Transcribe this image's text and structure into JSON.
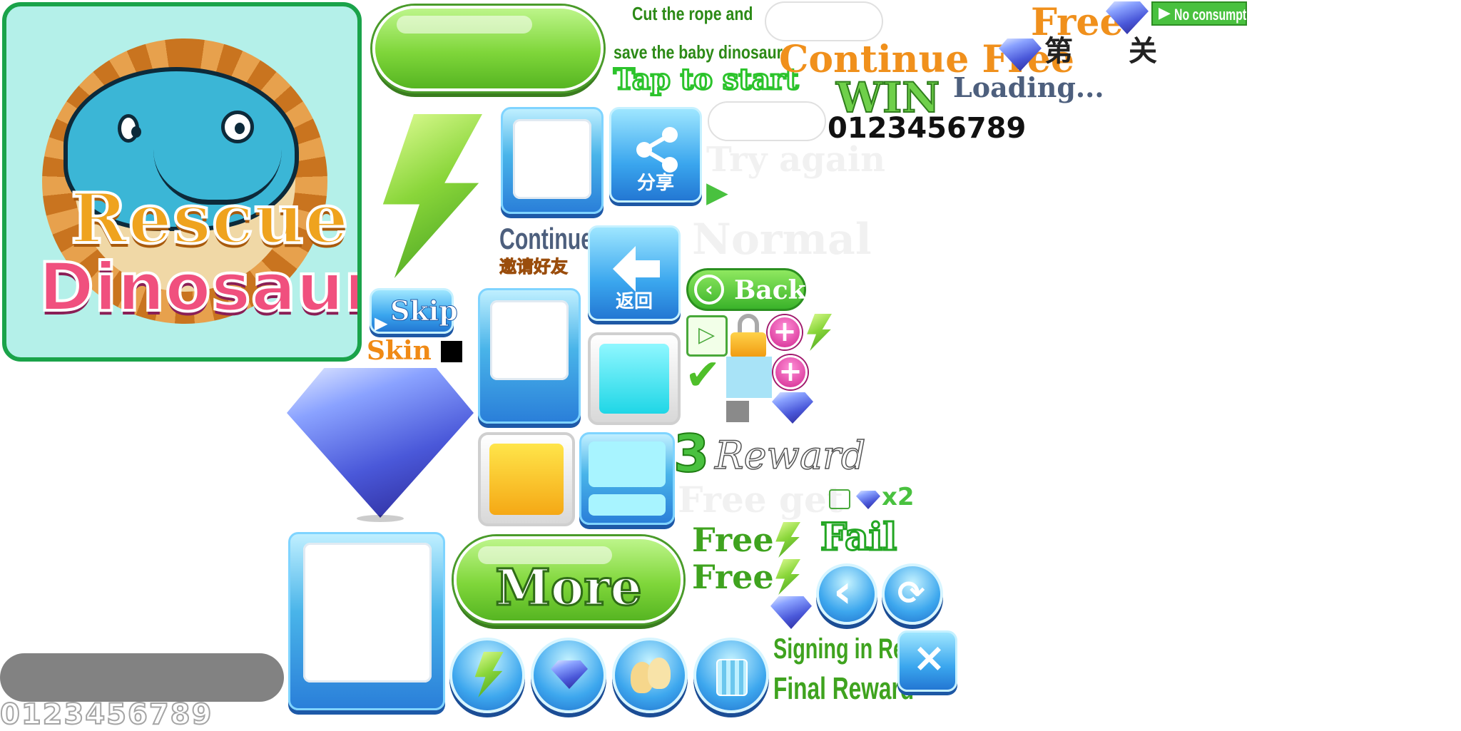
{
  "logo": {
    "title_line1": "Rescue",
    "title_line2": "Dinosaur"
  },
  "text": {
    "cut_rope": "Cut the rope and",
    "save_baby": "save the baby dinosaur",
    "tap_to_start": "Tap to start",
    "continue_free": "Continue Free",
    "free_top": "Free",
    "no_consumption": "No consumption",
    "level_di": "第",
    "level_guan": "关",
    "win": "WIN",
    "loading": "Loading...",
    "digits_dark": "0123456789",
    "try_again": "Try again",
    "normal": "Normal",
    "share_sub": "分享",
    "continue": "Continue",
    "invite_friends": "邀请好友",
    "back_sub": "返回",
    "back": "Back",
    "skip": "Skip",
    "skin": "Skin",
    "reward_num": "3",
    "reward": "Reward",
    "free_get": "Free get",
    "x2": "x2",
    "free_1": "Free",
    "free_2": "Free",
    "fail": "Fail",
    "more": "More",
    "signing_reward": "Signing in Reward",
    "final_reward": "Final Reward",
    "digits_outline": "0123456789"
  },
  "colors": {
    "logo_border": "#1aa34a",
    "logo_bg": "#b4f0e9",
    "orange": "#f0901c",
    "green": "#3fa31f",
    "slate": "#4d5f7d",
    "blue": "#3aa6ee"
  },
  "icons": [
    "lightning-icon",
    "share-icon",
    "back-arrow-icon",
    "play-video-icon",
    "lock-icon",
    "plus-icon",
    "checkmark-icon",
    "diamond-icon",
    "refresh-icon",
    "close-icon",
    "friends-icon",
    "shirt-icon"
  ]
}
